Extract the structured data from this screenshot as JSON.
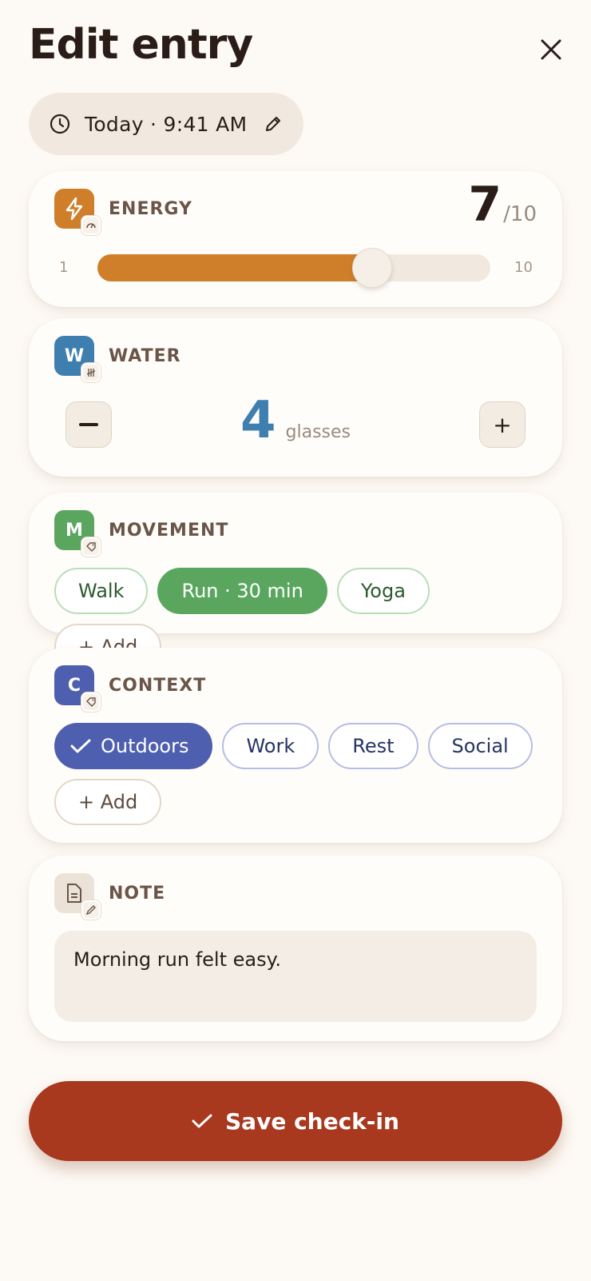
{
  "header": {
    "title": "Edit entry",
    "close_icon": "close-icon"
  },
  "timestamp": {
    "label": "Today · 9:41 AM",
    "clock_icon": "clock-icon",
    "edit_icon": "pencil-icon"
  },
  "energy": {
    "label": "ENERGY",
    "value": "7",
    "max_label": "/10",
    "level": 0.7,
    "scale_min": "1",
    "scale_max": "10",
    "accent": "#cf7f2a"
  },
  "water": {
    "label": "WATER",
    "badge_letter": "W",
    "count": "4",
    "unit": "glasses",
    "decrement": "−",
    "increment": "+",
    "accent": "#3f7fb0"
  },
  "movement": {
    "label": "MOVEMENT",
    "badge_letter": "M",
    "chips": [
      "Walk",
      "Run · 30 min",
      "Yoga"
    ],
    "selected": "Run · 30 min",
    "add_label": "+ Add",
    "accent": "#5aa65f"
  },
  "context": {
    "label": "CONTEXT",
    "badge_letter": "C",
    "chips": [
      "Outdoors",
      "Work",
      "Rest",
      "Social"
    ],
    "selected": "Outdoors",
    "add_label": "+ Add",
    "accent": "#4f5fb0"
  },
  "note": {
    "label": "NOTE",
    "text": "Morning run felt easy."
  },
  "save": {
    "label": "Save check-in",
    "accent": "#a8381e"
  }
}
